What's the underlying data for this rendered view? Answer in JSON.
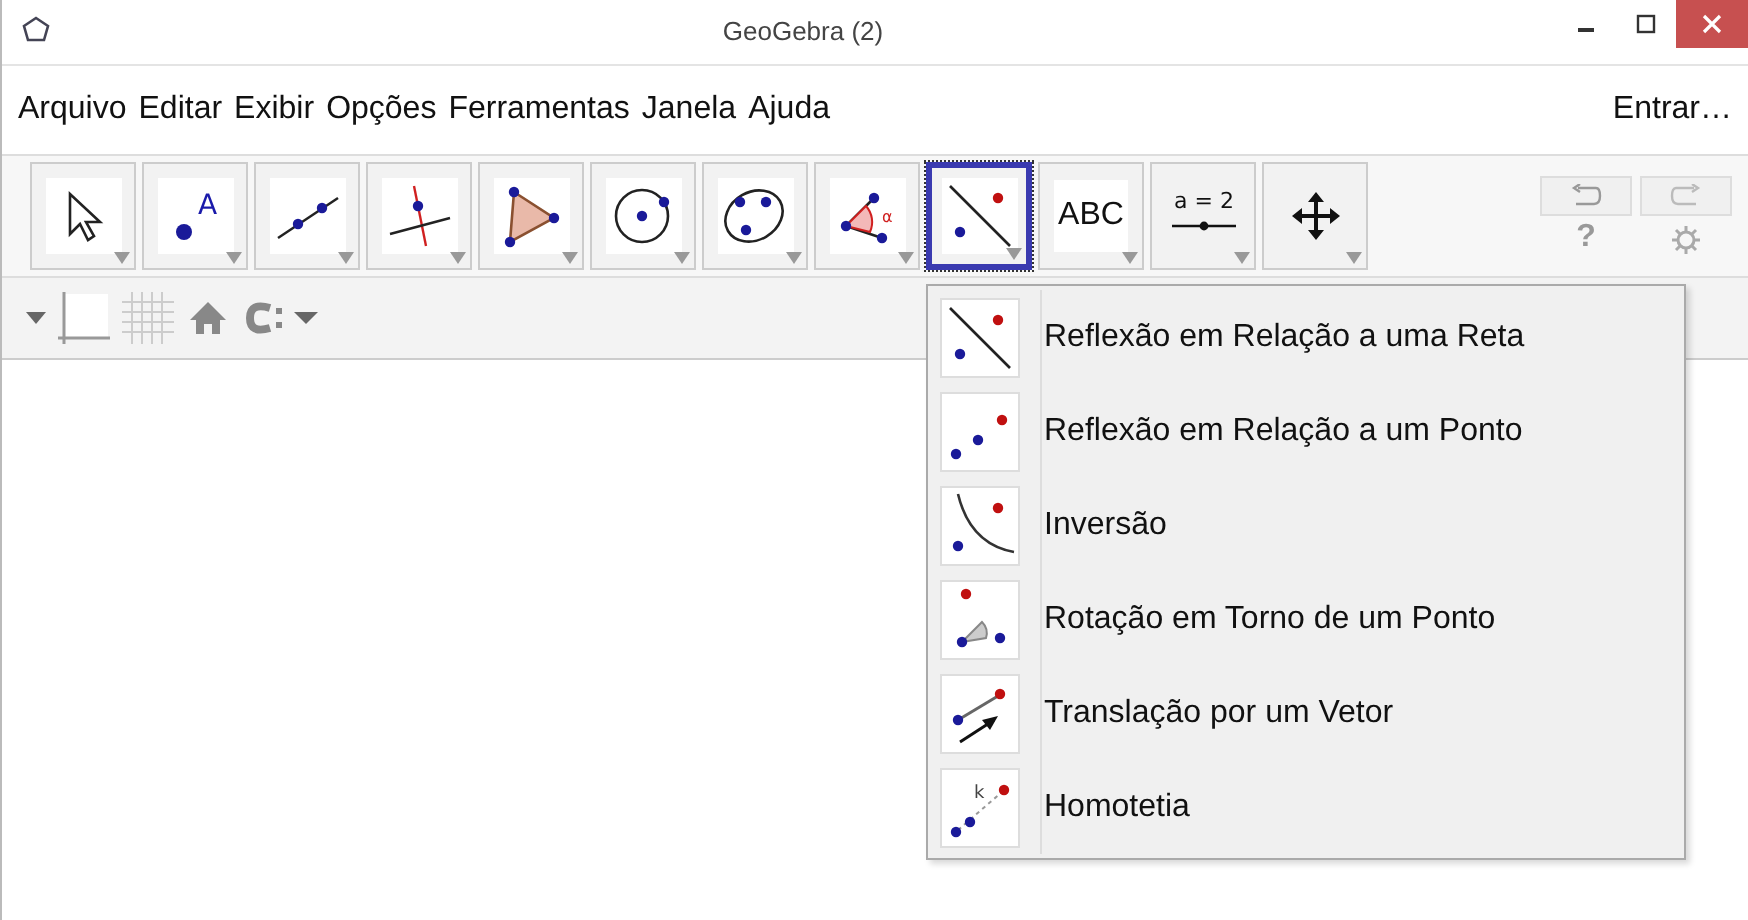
{
  "window": {
    "title": "GeoGebra (2)"
  },
  "menu_bar": {
    "items": [
      {
        "label": "Arquivo"
      },
      {
        "label": "Editar"
      },
      {
        "label": "Exibir"
      },
      {
        "label": "Opções"
      },
      {
        "label": "Ferramentas"
      },
      {
        "label": "Janela"
      },
      {
        "label": "Ajuda"
      }
    ],
    "sign_in": "Entrar…"
  },
  "toolbar": {
    "tools": [
      {
        "kind": "move",
        "selected": false
      },
      {
        "kind": "point",
        "label": "A",
        "selected": false
      },
      {
        "kind": "line",
        "selected": false
      },
      {
        "kind": "perpendicular",
        "selected": false
      },
      {
        "kind": "polygon",
        "selected": false
      },
      {
        "kind": "circle",
        "selected": false
      },
      {
        "kind": "conic",
        "selected": false
      },
      {
        "kind": "angle",
        "label": "α",
        "selected": false
      },
      {
        "kind": "reflect-line",
        "selected": true
      },
      {
        "kind": "text",
        "label": "ABC",
        "selected": false
      },
      {
        "kind": "slider",
        "label": "a = 2",
        "selected": false
      },
      {
        "kind": "pan",
        "selected": false
      }
    ],
    "help": "?"
  },
  "tool_menu": {
    "items": [
      {
        "kind": "reflect-line",
        "label": "Reflexão em Relação a uma Reta"
      },
      {
        "kind": "reflect-point",
        "label": "Reflexão em Relação a um Ponto"
      },
      {
        "kind": "inversion",
        "label": "Inversão"
      },
      {
        "kind": "rotation",
        "label": "Rotação em Torno de um Ponto"
      },
      {
        "kind": "translation",
        "label": "Translação por um Vetor"
      },
      {
        "kind": "dilation",
        "label": "Homotetia",
        "icon_label": "k"
      }
    ]
  }
}
